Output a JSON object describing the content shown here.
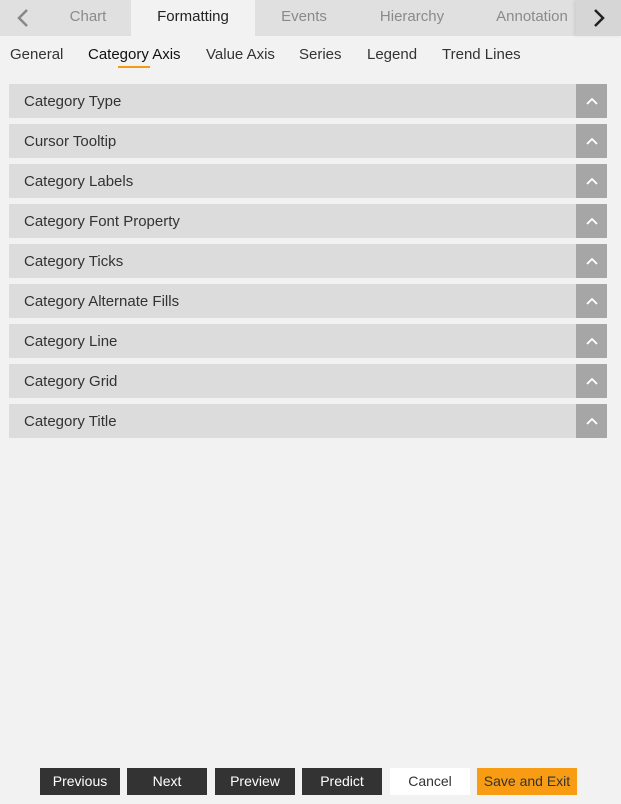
{
  "top_tabs": [
    {
      "label": "Chart"
    },
    {
      "label": "Formatting",
      "active": true
    },
    {
      "label": "Events"
    },
    {
      "label": "Hierarchy"
    },
    {
      "label": "Annotation"
    }
  ],
  "sub_tabs": [
    {
      "label": "General"
    },
    {
      "label": "Category Axis",
      "active": true
    },
    {
      "label": "Value Axis"
    },
    {
      "label": "Series"
    },
    {
      "label": "Legend"
    },
    {
      "label": "Trend Lines"
    }
  ],
  "panels": [
    "Category Type",
    "Cursor Tooltip",
    "Category Labels",
    "Category Font Property",
    "Category Ticks",
    "Category Alternate Fills",
    "Category Line",
    "Category Grid",
    "Category Title"
  ],
  "footer": {
    "previous": "Previous",
    "next": "Next",
    "preview": "Preview",
    "predict": "Predict",
    "cancel": "Cancel",
    "save": "Save and Exit"
  },
  "colors": {
    "accent": "#f89c14",
    "dark_button": "#333333"
  }
}
